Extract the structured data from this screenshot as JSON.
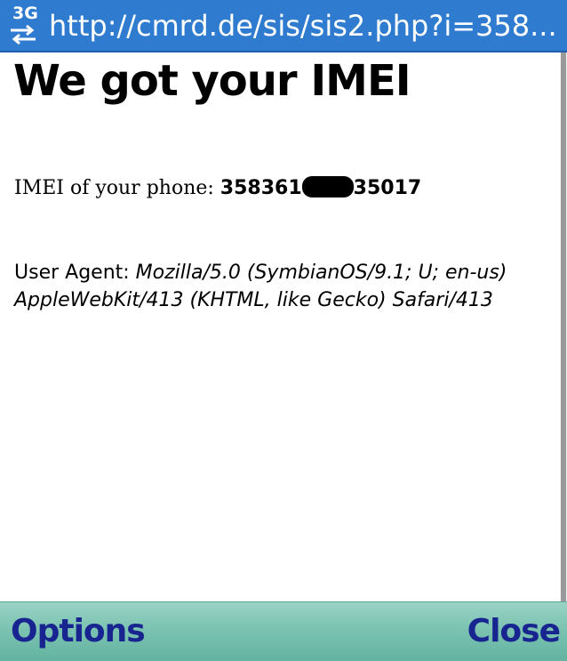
{
  "status_bar": {
    "network_type": "3G",
    "network_icon": "data-transfer-arrows-icon",
    "url": "http://cmrd.de/sis/sis2.php?i=358..."
  },
  "page": {
    "heading": "We got your IMEI",
    "imei_label": "IMEI of your phone:",
    "imei_prefix": "358361",
    "imei_suffix": "35017",
    "user_agent_label": "User Agent:",
    "user_agent_value": "Mozilla/5.0 (SymbianOS/9.1; U; en-us) AppleWebKit/413 (KHTML, like Gecko) Safari/413"
  },
  "softkeys": {
    "left_label": "Options",
    "right_label": "Close"
  },
  "colors": {
    "url_bar_background": "#2f7bd0",
    "softkey_bar": "#7cc3b2",
    "softkey_text": "#18248f"
  }
}
